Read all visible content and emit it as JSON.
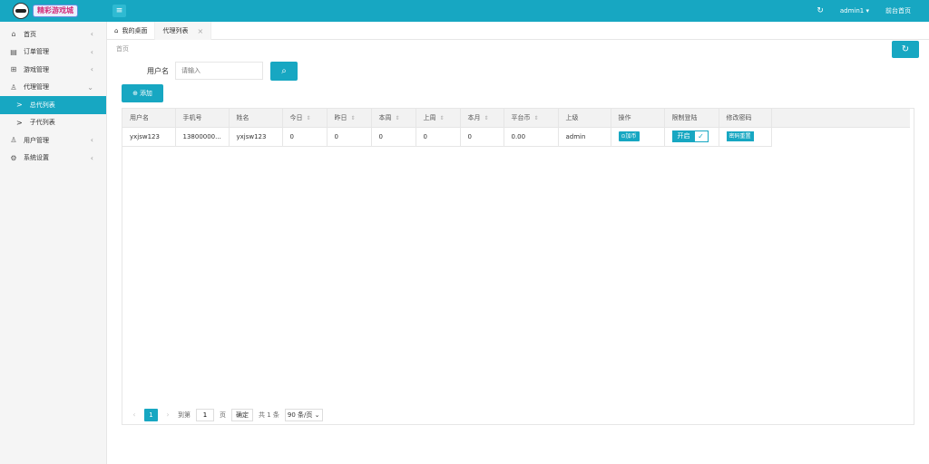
{
  "header": {
    "logo_text": "精彩游戏城",
    "menu_icon": "hamburger-icon",
    "refresh_icon": "refresh-icon",
    "user": "admin1 ▾",
    "front_link": "前台首页"
  },
  "sidebar": {
    "items": [
      {
        "label": "首页",
        "icon": "⌂"
      },
      {
        "label": "订单管理",
        "icon": "▤"
      },
      {
        "label": "游戏管理",
        "icon": "⊞"
      },
      {
        "label": "代理管理",
        "icon": "♙"
      },
      {
        "label": "总代列表",
        "icon": ">"
      },
      {
        "label": "子代列表",
        "icon": ">"
      },
      {
        "label": "用户管理",
        "icon": "♙"
      },
      {
        "label": "系统设置",
        "icon": "⚙"
      }
    ]
  },
  "tabs": {
    "home": "我的桌面",
    "current": "代理列表"
  },
  "breadcrumb": "首页",
  "search": {
    "label": "用户名",
    "placeholder": "请输入"
  },
  "add_label": "添加",
  "table": {
    "headers": [
      "用户名",
      "手机号",
      "姓名",
      "今日",
      "昨日",
      "本周",
      "上周",
      "本月",
      "平台币",
      "上级",
      "操作",
      "限制登陆",
      "修改密码"
    ],
    "rows": [
      {
        "username": "yxjsw123",
        "phone": "13800000...",
        "name": "yxjsw123",
        "today": "0",
        "yesterday": "0",
        "this_week": "0",
        "last_week": "0",
        "this_month": "0",
        "coins": "0.00",
        "parent": "admin",
        "op_label": "加币",
        "limit_label": "开启",
        "reset_label": "密码重置"
      }
    ]
  },
  "pager": {
    "current_page": "1",
    "goto_label": "到第",
    "goto_value": "1",
    "page_unit": "页",
    "confirm": "确定",
    "total": "共 1 条",
    "per_page": "90 条/页 ⌄"
  }
}
